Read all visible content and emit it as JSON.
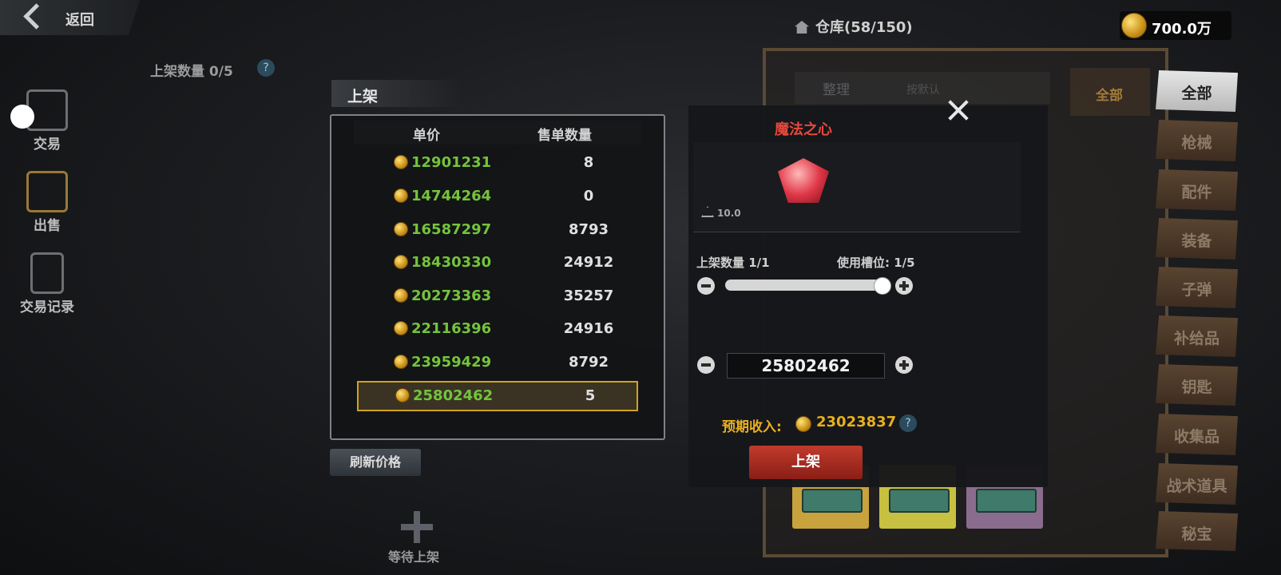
{
  "topbar": {
    "back_label": "返回",
    "warehouse": "仓库(58/150)",
    "gold": "700.0万"
  },
  "nav": {
    "items": [
      {
        "label": "交易",
        "icon": "cart-icon"
      },
      {
        "label": "出售",
        "icon": "sell-cart-icon"
      },
      {
        "label": "交易记录",
        "icon": "record-icon"
      }
    ]
  },
  "listing": {
    "slots": "上架数量 0/5",
    "help": "?",
    "panel_title": "上架",
    "columns": {
      "price": "单价",
      "qty": "售单数量"
    },
    "rows": [
      {
        "price": "12901231",
        "qty": "8"
      },
      {
        "price": "14744264",
        "qty": "0"
      },
      {
        "price": "16587297",
        "qty": "8793"
      },
      {
        "price": "18430330",
        "qty": "24912"
      },
      {
        "price": "20273363",
        "qty": "35257"
      },
      {
        "price": "22116396",
        "qty": "24916"
      },
      {
        "price": "23959429",
        "qty": "8792"
      },
      {
        "price": "25802462",
        "qty": "5"
      }
    ],
    "refresh": "刷新价格",
    "waiting": "等待上架"
  },
  "inventory": {
    "sort_dim": "整理",
    "sort_dim2": "按默认",
    "all_dim": "全部",
    "categories": [
      "全部",
      "枪械",
      "配件",
      "装备",
      "子弹",
      "补给品",
      "钥匙",
      "收集品",
      "战术道具",
      "秘宝"
    ]
  },
  "popup": {
    "item_name": "魔法之心",
    "weight": "10.0",
    "qty_label": "上架数量 1/1",
    "slot_label": "使用槽位: 1/5",
    "slider_fraction": 1.0,
    "price_value": "25802462",
    "income_label": "预期收入:",
    "income_value": "23023837",
    "help": "?",
    "list_button": "上架"
  },
  "colors": {
    "price_green": "#74c43c",
    "gold": "#e8b020",
    "item_red": "#e8483c",
    "select_gold": "#d1a21c"
  }
}
